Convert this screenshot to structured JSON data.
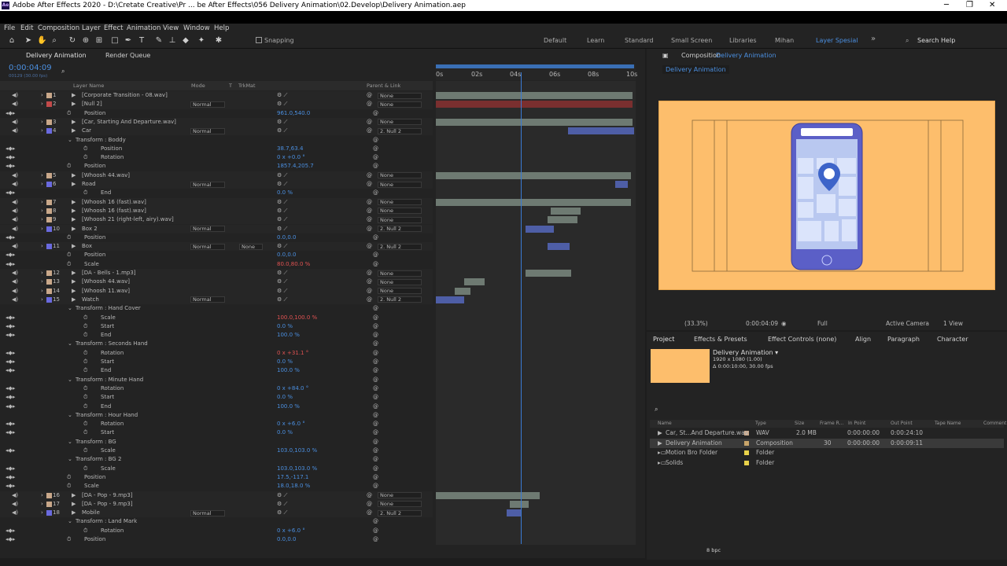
{
  "window": {
    "title": "Adobe After Effects 2020 - D:\\Cretate Creative\\Pr ... be After Effects\\056 Delivery Animation\\02.Develop\\Delivery Animation.aep",
    "logo": "Ae",
    "minimize": "─",
    "maximize": "❐",
    "close": "✕"
  },
  "menu": [
    "File",
    "Edit",
    "Composition",
    "Layer",
    "Effect",
    "Animation",
    "View",
    "Window",
    "Help"
  ],
  "toolbar": {
    "snapping": "Snapping",
    "workspaces": [
      "Default",
      "Learn",
      "Standard",
      "Small Screen",
      "Libraries",
      "Mihan",
      "Layer Spesial"
    ],
    "search": "Search Help"
  },
  "timeline": {
    "tab": "Delivery Animation",
    "render_tab": "Render Queue",
    "timecode": "0:00:04:09",
    "frames": "00129 (30.00 fps)",
    "header": {
      "layer_name": "Layer Name",
      "mode": "Mode",
      "t": "T",
      "trkmat": "TrkMat",
      "parent": "Parent & Link"
    },
    "ruler": [
      "0s",
      "02s",
      "04s",
      "06s",
      "08s",
      "10s"
    ],
    "rows": [
      {
        "n": "1",
        "name": "[Corporate Transition - 08.wav]",
        "mode": "",
        "parent": "None",
        "type": "layer",
        "color": "#c9a88a"
      },
      {
        "n": "2",
        "name": "[Null 2]",
        "mode": "Normal",
        "parent": "None",
        "type": "layer",
        "color": "#c24a4a"
      },
      {
        "name": "Position",
        "value": "961.0,540.0",
        "type": "prop"
      },
      {
        "n": "3",
        "name": "[Car, Starting And Departure.wav]",
        "mode": "",
        "parent": "None",
        "type": "layer",
        "color": "#c9a88a"
      },
      {
        "n": "4",
        "name": "Car",
        "mode": "Normal",
        "parent": "2. Null 2",
        "type": "layer",
        "color": "#6a6adf"
      },
      {
        "name": "Transform : Boddy",
        "value": "",
        "type": "group"
      },
      {
        "name": "Position",
        "value": "38.7,63.4",
        "type": "prop2"
      },
      {
        "name": "Rotation",
        "value": "0 x +0.0 °",
        "type": "prop2"
      },
      {
        "name": "Position",
        "value": "1857.4,205.7",
        "type": "prop"
      },
      {
        "n": "5",
        "name": "[Whoosh 44.wav]",
        "mode": "",
        "parent": "None",
        "type": "layer",
        "color": "#c9a88a"
      },
      {
        "n": "6",
        "name": "Road",
        "mode": "Normal",
        "parent": "None",
        "type": "layer",
        "color": "#6a6adf"
      },
      {
        "name": "End",
        "value": "0.0 %",
        "type": "prop2"
      },
      {
        "n": "7",
        "name": "[Whoosh 16 (fast).wav]",
        "mode": "",
        "parent": "None",
        "type": "layer",
        "color": "#c9a88a"
      },
      {
        "n": "8",
        "name": "[Whoosh 16 (fast).wav]",
        "mode": "",
        "parent": "None",
        "type": "layer",
        "color": "#c9a88a"
      },
      {
        "n": "9",
        "name": "[Whoosh 21 (right-left, airy).wav]",
        "mode": "",
        "parent": "None",
        "type": "layer",
        "color": "#c9a88a"
      },
      {
        "n": "10",
        "name": "Box 2",
        "mode": "Normal",
        "parent": "2. Null 2",
        "type": "layer",
        "color": "#6a6adf"
      },
      {
        "name": "Position",
        "value": "0.0,0.0",
        "type": "prop"
      },
      {
        "n": "11",
        "name": "Box",
        "mode": "Normal",
        "trk": "None",
        "parent": "2. Null 2",
        "type": "layer",
        "color": "#6a6adf"
      },
      {
        "name": "Position",
        "value": "0.0,0.0",
        "type": "prop"
      },
      {
        "name": "Scale",
        "value": "80.0,80.0 %",
        "type": "prop",
        "red": true
      },
      {
        "n": "12",
        "name": "[DA - Bells - 1.mp3]",
        "mode": "",
        "parent": "None",
        "type": "layer",
        "color": "#c9a88a"
      },
      {
        "n": "13",
        "name": "[Whoosh 44.wav]",
        "mode": "",
        "parent": "None",
        "type": "layer",
        "color": "#c9a88a"
      },
      {
        "n": "14",
        "name": "[Whoosh 11.wav]",
        "mode": "",
        "parent": "None",
        "type": "layer",
        "color": "#c9a88a"
      },
      {
        "n": "15",
        "name": "Watch",
        "mode": "Normal",
        "parent": "2. Null 2",
        "type": "layer",
        "color": "#6a6adf"
      },
      {
        "name": "Transform : Hand Cover",
        "value": "",
        "type": "group"
      },
      {
        "name": "Scale",
        "value": "100.0,100.0 %",
        "type": "prop2",
        "red": true
      },
      {
        "name": "Start",
        "value": "0.0 %",
        "type": "prop2"
      },
      {
        "name": "End",
        "value": "100.0 %",
        "type": "prop2"
      },
      {
        "name": "Transform : Seconds Hand",
        "value": "",
        "type": "group"
      },
      {
        "name": "Rotation",
        "value": "0 x +31.1 °",
        "type": "prop2",
        "red": true
      },
      {
        "name": "Start",
        "value": "0.0 %",
        "type": "prop2"
      },
      {
        "name": "End",
        "value": "100.0 %",
        "type": "prop2"
      },
      {
        "name": "Transform : Minute Hand",
        "value": "",
        "type": "group"
      },
      {
        "name": "Rotation",
        "value": "0 x +84.0 °",
        "type": "prop2"
      },
      {
        "name": "Start",
        "value": "0.0 %",
        "type": "prop2"
      },
      {
        "name": "End",
        "value": "100.0 %",
        "type": "prop2"
      },
      {
        "name": "Transform : Hour Hand",
        "value": "",
        "type": "group"
      },
      {
        "name": "Rotation",
        "value": "0 x +6.0 °",
        "type": "prop2"
      },
      {
        "name": "Start",
        "value": "0.0 %",
        "type": "prop2"
      },
      {
        "name": "Transform : BG",
        "value": "",
        "type": "group"
      },
      {
        "name": "Scale",
        "value": "103.0,103.0 %",
        "type": "prop2"
      },
      {
        "name": "Transform : BG 2",
        "value": "",
        "type": "group"
      },
      {
        "name": "Scale",
        "value": "103.0,103.0 %",
        "type": "prop2"
      },
      {
        "name": "Position",
        "value": "17.5,-117.1",
        "type": "prop"
      },
      {
        "name": "Scale",
        "value": "18.0,18.0 %",
        "type": "prop"
      },
      {
        "n": "16",
        "name": "[DA - Pop - 9.mp3]",
        "mode": "",
        "parent": "None",
        "type": "layer",
        "color": "#c9a88a"
      },
      {
        "n": "17",
        "name": "[DA - Pop - 9.mp3]",
        "mode": "",
        "parent": "None",
        "type": "layer",
        "color": "#c9a88a"
      },
      {
        "n": "18",
        "name": "Mobile",
        "mode": "Normal",
        "parent": "2. Null 2",
        "type": "layer",
        "color": "#6a6adf"
      },
      {
        "name": "Transform : Land Mark",
        "value": "",
        "type": "group"
      },
      {
        "name": "Rotation",
        "value": "0 x +6.0 °",
        "type": "prop2"
      },
      {
        "name": "Position",
        "value": "0.0,0.0",
        "type": "prop"
      }
    ]
  },
  "composition": {
    "tab": "Composition",
    "name": "Delivery Animation",
    "crumb": "Delivery Animation",
    "zoom": "(33.3%)",
    "time": "0:00:04:09",
    "res": "Full",
    "camera": "Active Camera",
    "views": "1 View"
  },
  "project": {
    "tabs": [
      "Project",
      "Effects & Presets",
      "Effect Controls (none)",
      "Align",
      "Paragraph",
      "Character"
    ],
    "comp_name": "Delivery Animation ▾",
    "comp_size": "1920 x 1080 (1.00)",
    "comp_dur": "Δ 0:00:10:00, 30.00 fps",
    "cols": [
      "Name",
      "Type",
      "Size",
      "Frame R...",
      "In Point",
      "Out Point",
      "Tape Name",
      "Comment"
    ],
    "items": [
      {
        "name": "Car, St...And Departure.wav",
        "type": "WAV",
        "size": "2.0 MB",
        "fr": "",
        "in": "0:00:00:00",
        "out": "0:00:24:10",
        "color": "#c9a88a"
      },
      {
        "name": "Delivery Animation",
        "type": "Composition",
        "size": "",
        "fr": "30",
        "in": "0:00:00:00",
        "out": "0:00:09:11",
        "color": "#c8a46a"
      },
      {
        "name": "Motion Bro Folder",
        "type": "Folder",
        "size": "",
        "fr": "",
        "in": "",
        "out": "",
        "color": "#e8d24a"
      },
      {
        "name": "Solids",
        "type": "Folder",
        "size": "",
        "fr": "",
        "in": "",
        "out": "",
        "color": "#e8d24a"
      }
    ],
    "bpc": "8 bpc"
  }
}
